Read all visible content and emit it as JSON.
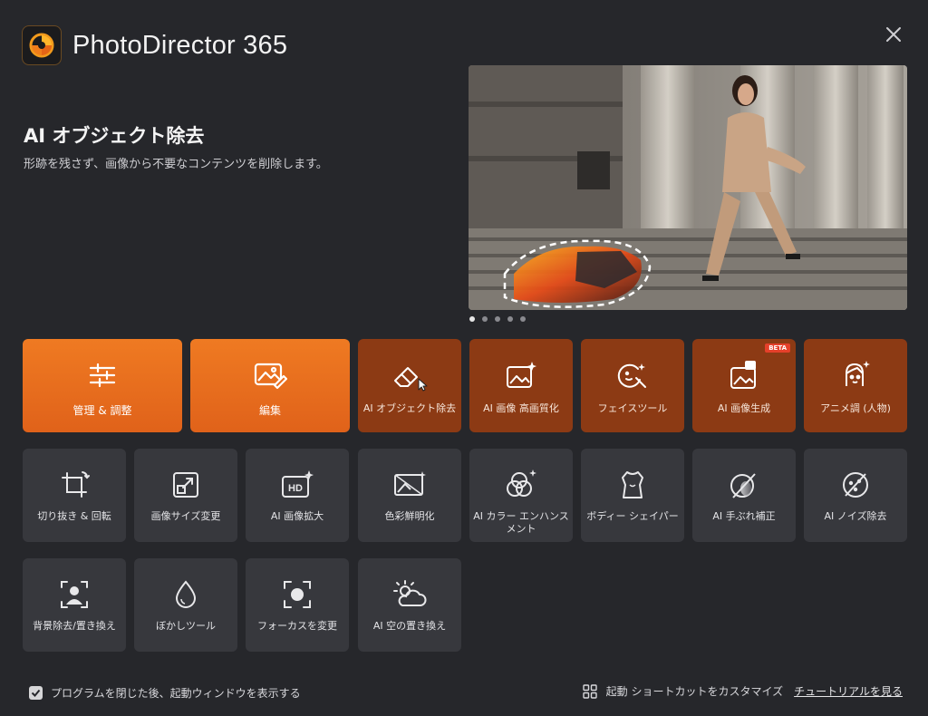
{
  "app": {
    "title": "PhotoDirector 365"
  },
  "feature": {
    "title": "AI オブジェクト除去",
    "description": "形跡を残さず、画像から不要なコンテンツを削除します。"
  },
  "carousel": {
    "count": 5,
    "active_index": 0
  },
  "primary_tiles": [
    {
      "label": "管理 & 調整",
      "icon": "sliders-icon"
    },
    {
      "label": "編集",
      "icon": "photo-edit-icon"
    }
  ],
  "ai_tiles": [
    {
      "label": "AI オブジェクト除去",
      "icon": "eraser-icon"
    },
    {
      "label": "AI 画像 高画質化",
      "icon": "image-sparkle-icon"
    },
    {
      "label": "フェイスツール",
      "icon": "face-wand-icon"
    },
    {
      "label": "AI 画像生成",
      "icon": "image-generate-icon",
      "badge": "BETA"
    },
    {
      "label": "アニメ調 (人物)",
      "icon": "anime-face-icon"
    }
  ],
  "tool_tiles_row1": [
    {
      "label": "切り抜き & 回転",
      "icon": "crop-rotate-icon"
    },
    {
      "label": "画像サイズ変更",
      "icon": "resize-icon"
    },
    {
      "label": "AI 画像拡大",
      "icon": "hd-upscale-icon"
    },
    {
      "label": "色彩鮮明化",
      "icon": "color-enhance-icon"
    },
    {
      "label": "AI カラー エンハンスメント",
      "icon": "color-circles-icon"
    },
    {
      "label": "ボディー シェイパー",
      "icon": "body-shaper-icon"
    },
    {
      "label": "AI 手ぶれ補正",
      "icon": "deblur-icon"
    },
    {
      "label": "AI ノイズ除去",
      "icon": "denoise-icon"
    }
  ],
  "tool_tiles_row2": [
    {
      "label": "背景除去/置き換え",
      "icon": "person-frame-icon"
    },
    {
      "label": "ぼかしツール",
      "icon": "drop-icon"
    },
    {
      "label": "フォーカスを変更",
      "icon": "focus-icon"
    },
    {
      "label": "AI 空の置き換え",
      "icon": "sky-icon"
    }
  ],
  "footer": {
    "show_on_close_label": "プログラムを閉じた後、起動ウィンドウを表示する",
    "show_on_close_checked": true,
    "customize_label": "起動 ショートカットをカスタマイズ",
    "tutorial_label": "チュートリアルを見る"
  },
  "colors": {
    "background": "#26272b",
    "primary_orange": "#e96e1f",
    "ai_tile": "#8c3a14",
    "tool_tile": "#37383d",
    "beta_badge": "#e5402a"
  }
}
